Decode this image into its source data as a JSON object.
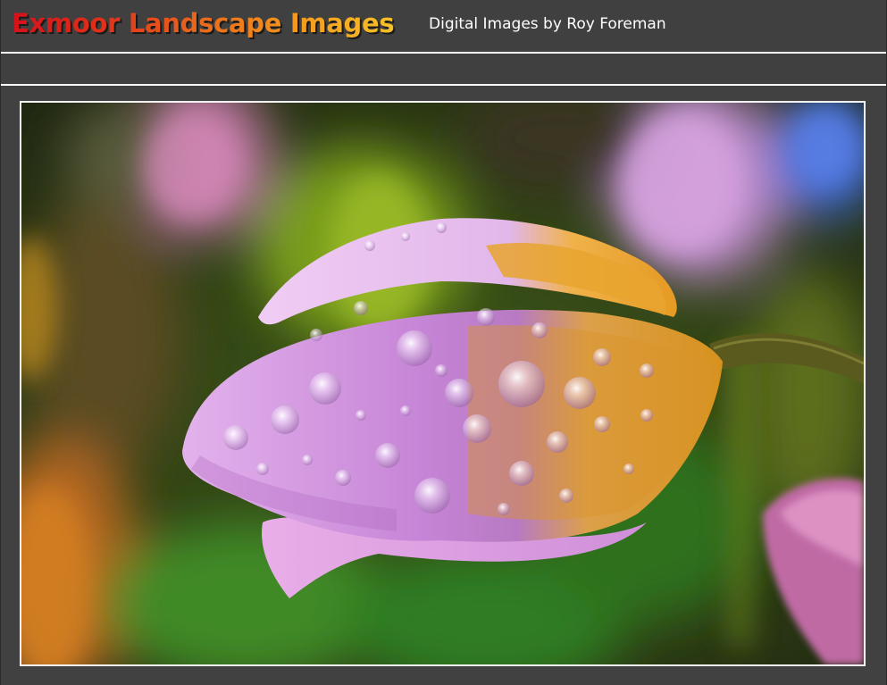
{
  "header": {
    "title": "Exmoor Landscape Images",
    "subtitle": "Digital Images by Roy Foreman"
  },
  "photo": {
    "subject": "tulip-bud-with-raindrops",
    "colors": {
      "petal": "#c98fd6",
      "petal_tip": "#e9a33a",
      "background_green": "#4f7a1e"
    }
  }
}
